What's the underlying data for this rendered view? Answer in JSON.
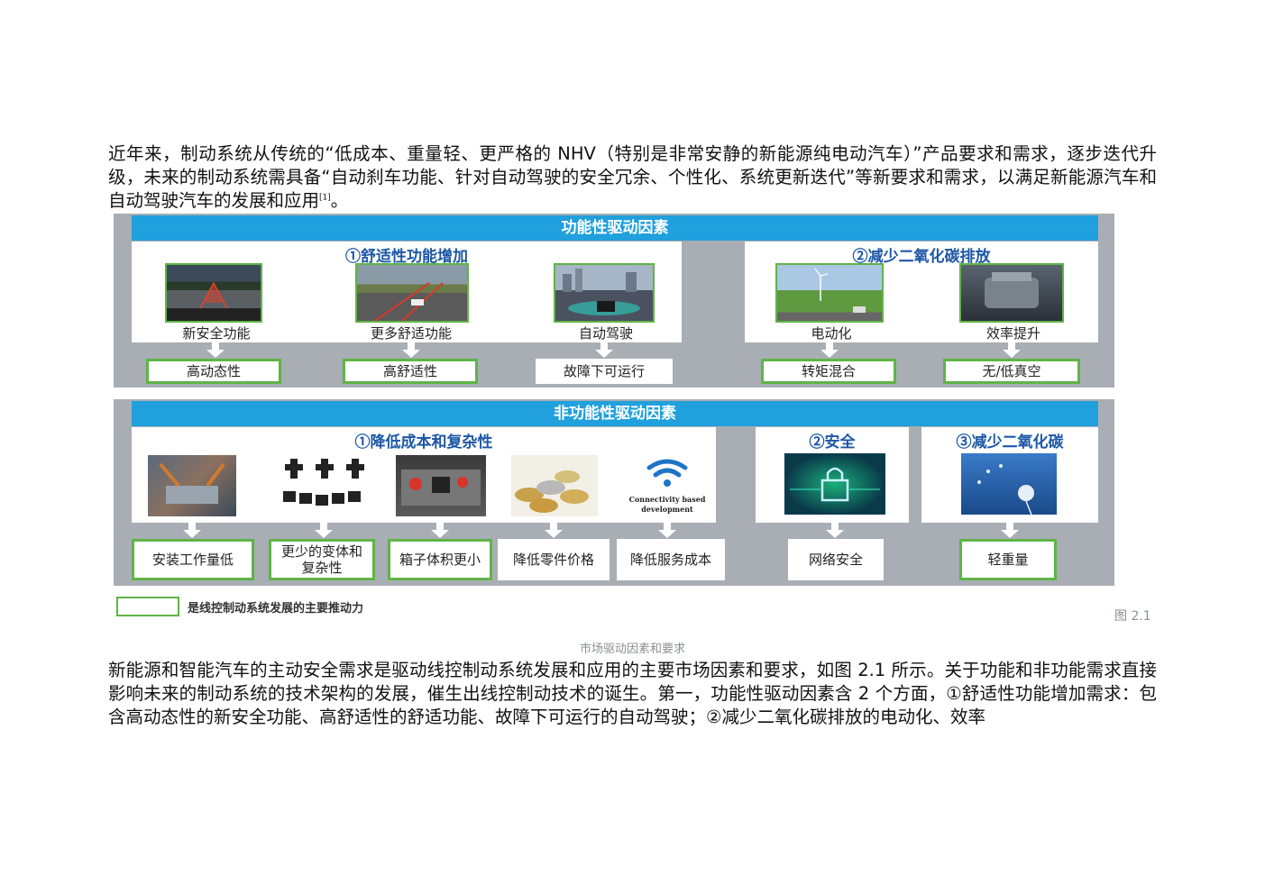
{
  "paragraph1": {
    "text": "近年来，制动系统从传统的“低成本、重量轻、更严格的 NHV（特别是非常安静的新能源纯电动汽车）”产品要求和需求，逐步迭代升级，未来的制动系统需具备“自动刹车功能、针对自动驾驶的安全冗余、个性化、系统更新迭代”等新要求和需求，以满足新能源汽车和自动驾驶汽车的发展和应用",
    "citation": "[1]",
    "tail": "。"
  },
  "figure": {
    "top_band": "功能性驱动因素",
    "group_comfort": "①舒适性功能增加",
    "group_co2": "②减少二氧化碳排放",
    "top_items": [
      {
        "label": "新安全功能",
        "result": "高动态性",
        "icon": "adas-radar-image"
      },
      {
        "label": "更多舒适功能",
        "result": "高舒适性",
        "icon": "highway-cars-image"
      },
      {
        "label": "自动驾驶",
        "result": "故障下可运行",
        "icon": "autonomous-city-image"
      },
      {
        "label": "电动化",
        "result": "转矩混合",
        "icon": "wind-turbine-image"
      },
      {
        "label": "效率提升",
        "result": "无/低真空",
        "icon": "engine-image"
      }
    ],
    "bottom_band": "非功能性驱动因素",
    "group_cost": "①降低成本和复杂性",
    "group_safety": "②安全",
    "group_co2b": "③减少二氧化碳",
    "connectivity_text": "Connectivity based development",
    "bottom_items": [
      {
        "result": "安装工作量低",
        "icon": "assembly-robot-image"
      },
      {
        "result": "更少的变体和复杂性",
        "icon": "sensor-parts-image"
      },
      {
        "result": "箱子体积更小",
        "icon": "engine-bay-image"
      },
      {
        "result": "降低零件价格",
        "icon": "coins-image"
      },
      {
        "result": "降低服务成本",
        "icon": "wifi-icon"
      },
      {
        "result": "网络安全",
        "icon": "padlock-circuit-image"
      },
      {
        "result": "轻重量",
        "icon": "dandelion-image"
      }
    ],
    "legend": "是线控制动系统发展的主要推动力",
    "number": "图 2.1",
    "caption": "市场驱动因素和要求"
  },
  "paragraph2": {
    "text": "新能源和智能汽车的主动安全需求是驱动线控制动系统发展和应用的主要市场因素和要求，如图 2.1 所示。关于功能和非功能需求直接影响未来的制动系统的技术架构的发展，催生出线控制动技术的诞生。第一，功能性驱动因素含 2 个方面，①舒适性功能增加需求：包含高动态性的新安全功能、高舒适性的舒适功能、故障下可运行的自动驾驶；②减少二氧化碳排放的电动化、效率"
  }
}
